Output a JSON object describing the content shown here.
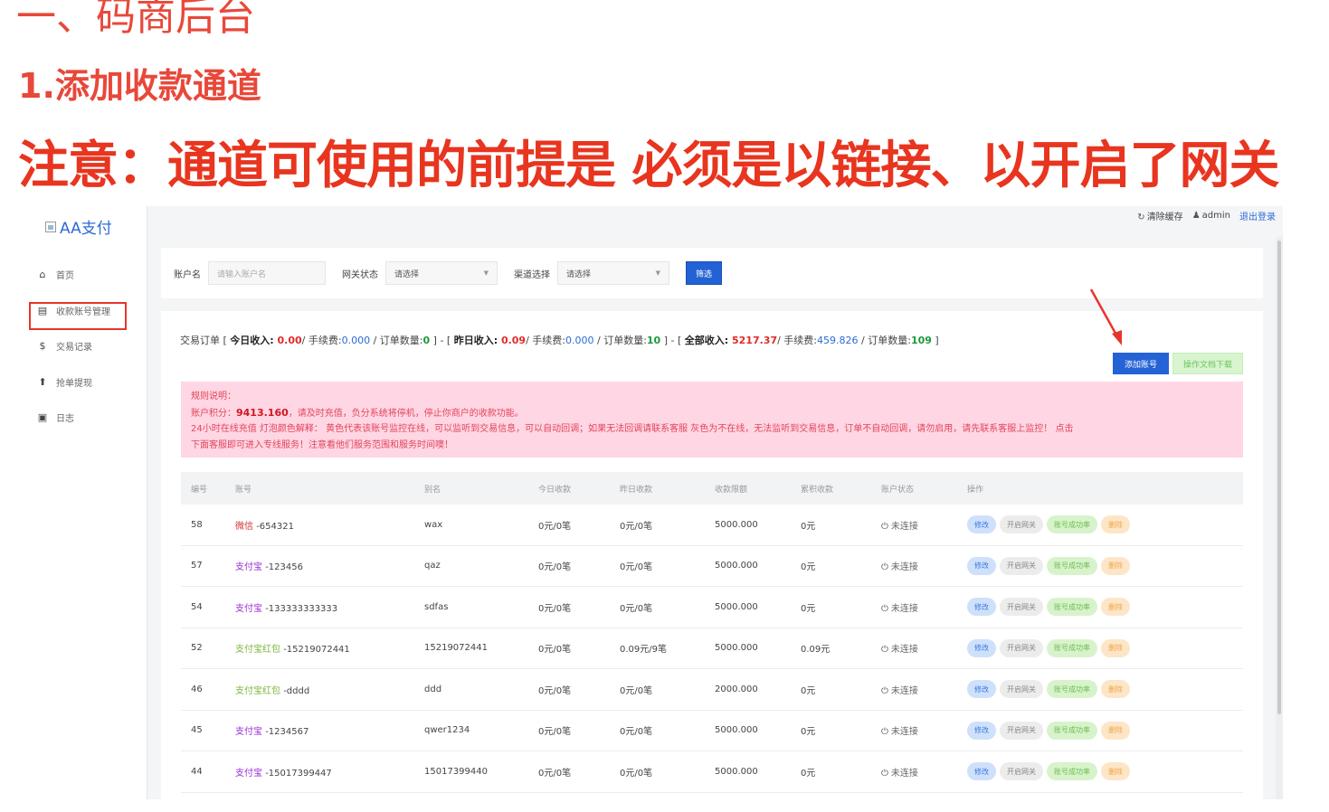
{
  "headings": {
    "chapter": "一、码商后台",
    "section": "1.添加收款通道",
    "notice": "注意：通道可使用的前提是 必须是以链接、以开启了网关"
  },
  "sidebar": {
    "logo": "AA支付",
    "items": [
      {
        "label": "首页",
        "icon": "home-icon"
      },
      {
        "label": "收款账号管理",
        "icon": "document-icon"
      },
      {
        "label": "交易记录",
        "icon": "dollar-icon"
      },
      {
        "label": "抢单提现",
        "icon": "upload-icon"
      },
      {
        "label": "日志",
        "icon": "book-icon"
      }
    ]
  },
  "topbar": {
    "clear_cache": "清除缓存",
    "user": "admin",
    "logout": "退出登录"
  },
  "filter": {
    "account_label": "账户名",
    "account_placeholder": "请输入账户名",
    "gateway_label": "网关状态",
    "gateway_value": "请选择",
    "channel_label": "渠道选择",
    "channel_value": "请选择",
    "filter_button": "筛选"
  },
  "summary": {
    "prefix": "交易订单 [ ",
    "today_label": "今日收入: ",
    "today_value": "0.00",
    "today_fee_label": "/ 手续费:",
    "today_fee": "0.000",
    "today_count_label": " / 订单数量:",
    "today_count": "0",
    "sep1": " ] - [ ",
    "yesterday_label": "昨日收入: ",
    "yesterday_value": "0.09",
    "yesterday_fee_label": "/ 手续费:",
    "yesterday_fee": "0.000",
    "yesterday_count_label": " / 订单数量:",
    "yesterday_count": "10",
    "sep2": " ] - [ ",
    "total_label": "全部收入: ",
    "total_value": "5217.37",
    "total_fee_label": "/ 手续费:",
    "total_fee": "459.826",
    "total_count_label": " / 订单数量:",
    "total_count": "109",
    "suffix": " ]"
  },
  "actions": {
    "add_account": "添加账号",
    "doc_download": "操作文档下载"
  },
  "notice_box": {
    "title": "规则说明：",
    "line1_prefix": "账户积分：",
    "score": "9413.160",
    "line1_suffix": "，请及时充值，负分系统将停机，停止你商户的收款功能。",
    "line2": "24小时在线充值 灯泡颜色解释： 黄色代表该账号监控在线，可以监听到交易信息，可以自动回调；如果无法回调请联系客服 灰色为不在线，无法监听到交易信息，订单不自动回调，请勿启用，请先联系客服上监控！ 点击",
    "line3": "下面客服即可进入专线服务！注意看他们服务范围和服务时间噢！"
  },
  "table": {
    "headers": [
      "编号",
      "账号",
      "别名",
      "今日收款",
      "昨日收款",
      "收款限额",
      "累积收款",
      "账户状态",
      "操作"
    ],
    "op_labels": {
      "edit": "修改",
      "gateway": "开启网关",
      "rate": "账号成功率",
      "delete": "删除"
    },
    "rows": [
      {
        "id": "58",
        "type": "微信",
        "account": "-654321",
        "alias": "wax",
        "today": "0元/0笔",
        "yesterday": "0元/0笔",
        "limit": "5000.000",
        "total": "0元",
        "status": "未连接"
      },
      {
        "id": "57",
        "type": "支付宝",
        "account": "-123456",
        "alias": "qaz",
        "today": "0元/0笔",
        "yesterday": "0元/0笔",
        "limit": "5000.000",
        "total": "0元",
        "status": "未连接"
      },
      {
        "id": "54",
        "type": "支付宝",
        "account": "-133333333333",
        "alias": "sdfas",
        "today": "0元/0笔",
        "yesterday": "0元/0笔",
        "limit": "5000.000",
        "total": "0元",
        "status": "未连接"
      },
      {
        "id": "52",
        "type": "支付宝红包",
        "account": "-15219072441",
        "alias": "15219072441",
        "today": "0元/0笔",
        "yesterday": "0.09元/9笔",
        "limit": "5000.000",
        "total": "0.09元",
        "status": "未连接"
      },
      {
        "id": "46",
        "type": "支付宝红包",
        "account": "-dddd",
        "alias": "ddd",
        "today": "0元/0笔",
        "yesterday": "0元/0笔",
        "limit": "2000.000",
        "total": "0元",
        "status": "未连接"
      },
      {
        "id": "45",
        "type": "支付宝",
        "account": "-1234567",
        "alias": "qwer1234",
        "today": "0元/0笔",
        "yesterday": "0元/0笔",
        "limit": "5000.000",
        "total": "0元",
        "status": "未连接"
      },
      {
        "id": "44",
        "type": "支付宝",
        "account": "-15017399447",
        "alias": "15017399440",
        "today": "0元/0笔",
        "yesterday": "0元/0笔",
        "limit": "5000.000",
        "total": "0元",
        "status": "未连接"
      }
    ]
  },
  "colors": {
    "accent": "#2462d6",
    "annotation_red": "#e8352b",
    "notice_bg": "#ffd6e4"
  }
}
